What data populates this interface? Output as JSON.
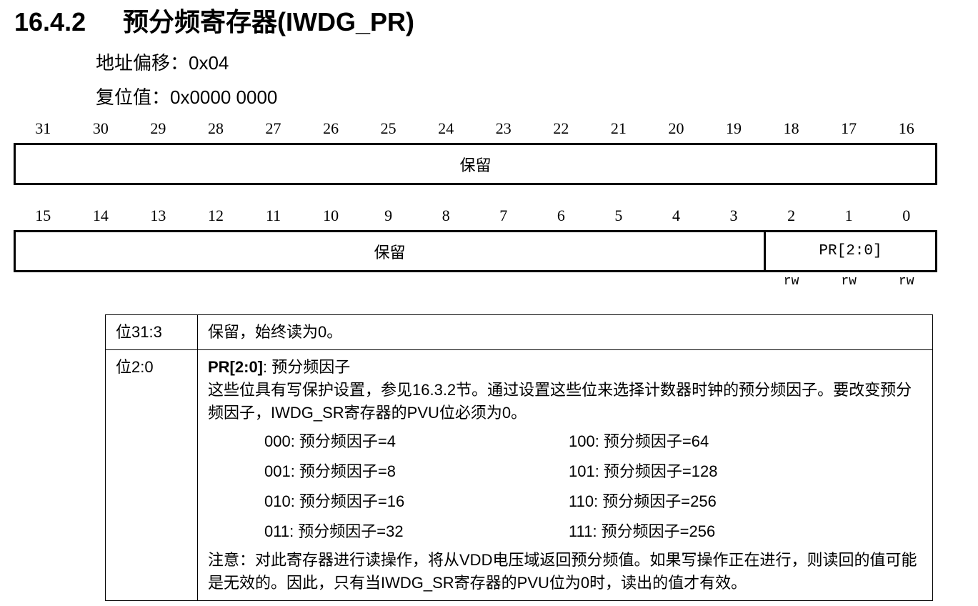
{
  "section": {
    "number": "16.4.2",
    "title": "预分频寄存器(IWDG_PR)"
  },
  "address_offset": "地址偏移：0x04",
  "reset_value": "复位值：0x0000 0000",
  "register": {
    "high_bits": [
      "31",
      "30",
      "29",
      "28",
      "27",
      "26",
      "25",
      "24",
      "23",
      "22",
      "21",
      "20",
      "19",
      "18",
      "17",
      "16"
    ],
    "low_bits": [
      "15",
      "14",
      "13",
      "12",
      "11",
      "10",
      "9",
      "8",
      "7",
      "6",
      "5",
      "4",
      "3",
      "2",
      "1",
      "0"
    ],
    "high_field": "保留",
    "low_reserved_field": "保留",
    "pr_field": "PR[2:0]",
    "access": [
      "rw",
      "rw",
      "rw"
    ]
  },
  "table": {
    "row1": {
      "label": "位31:3",
      "text": "保留，始终读为0。"
    },
    "row2": {
      "label": "位2:0",
      "field_name": "PR[2:0]",
      "field_desc": ": 预分频因子",
      "para1": "这些位具有写保护设置，参见16.3.2节。通过设置这些位来选择计数器时钟的预分频因子。要改变预分频因子，IWDG_SR寄存器的PVU位必须为0。",
      "prescalers": [
        "000: 预分频因子=4",
        "100: 预分频因子=64",
        "001: 预分频因子=8",
        "101: 预分频因子=128",
        "010: 预分频因子=16",
        "110: 预分频因子=256",
        "011: 预分频因子=32",
        "111: 预分频因子=256"
      ],
      "note": "注意：对此寄存器进行读操作，将从VDD电压域返回预分频值。如果写操作正在进行，则读回的值可能是无效的。因此，只有当IWDG_SR寄存器的PVU位为0时，读出的值才有效。"
    }
  }
}
